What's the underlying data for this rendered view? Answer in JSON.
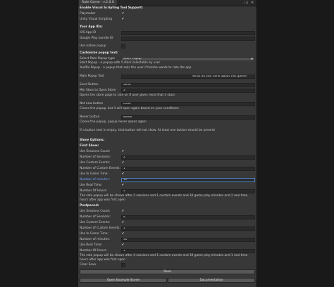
{
  "window": {
    "tab_title": "Rate Game - v.2.0.0",
    "menu_icon": "⋮",
    "restore_icon": "▫",
    "close_icon": "✕"
  },
  "visual_scripting": {
    "header": "Enable Visual Scripting Tool Support:",
    "playmaker_label": "Playmaker",
    "unity_label": "Unity Visual Scripting",
    "playmaker_checked": true,
    "unity_checked": true
  },
  "app_ids": {
    "header": "Your App IDs:",
    "ios_label": "iOS App ID",
    "google_label": "Google Play bundle ID",
    "ios_value": "",
    "google_value": "",
    "native_popup_label": "Use native popup",
    "native_popup_checked": false
  },
  "customize": {
    "header": "Customize popup text:",
    "popup_type_label": "Select Rate Popup type",
    "popup_type_value": "Stars Popup",
    "desc_start": "Start Popup - a popup with 5 stars selectable by user",
    "desc_yesno": "Yes/No Popup - a popup that asks the user if he/she wants to rate the app",
    "main_text_label": "Main Popup Text",
    "main_text_value": "What do you think about this game?",
    "send_label": "Send Button",
    "send_value": "Send",
    "min_stars_label": "Min Stars to Open Store",
    "min_stars_value": "3",
    "send_desc": "Opens the store page to rate on if user gives more that 3 stars",
    "not_now_label": "Not now button",
    "not_now_value": "Later",
    "not_now_desc": "Closes the popup, but it will open again based on your conditions",
    "never_label": "Never button",
    "never_value": "Never",
    "never_desc": "Closes the popup, popup never opens again",
    "empty_note": "If a button text is empty, that button will not show. At least one button should be present"
  },
  "show_options": {
    "header": "Show Options:",
    "first_header": "First Show:",
    "first": {
      "sessions_count_label": "Use Sessions Count:",
      "sessions_count_checked": true,
      "num_sessions_label": "Number of Sessions:",
      "num_sessions_value": "2",
      "custom_events_label": "Use Custom Events:",
      "custom_events_checked": true,
      "num_custom_label": "Number of Custom Events:",
      "num_custom_value": "1",
      "ingame_label": "Use In Game Time:",
      "ingame_checked": true,
      "num_minutes_label": "Number of minutes:",
      "num_minutes_value": "30",
      "real_time_label": "Use Real Time:",
      "real_time_checked": true,
      "num_hours_label": "Number Of Hours:",
      "num_hours_value": "2",
      "summary_1": "The rate popup will be shown after 2 sessions and 1 custom events and 30 game play minutes and 2 real time",
      "summary_2": "hours after app was first open"
    },
    "postponed_header": "Postponed:",
    "postponed": {
      "sessions_count_label": "Use Sessions Count:",
      "sessions_count_checked": true,
      "num_sessions_label": "Number of Sessions:",
      "num_sessions_value": "4",
      "custom_events_label": "Use Custom Events:",
      "custom_events_checked": true,
      "num_custom_label": "Number of Custom Events:",
      "num_custom_value": "1",
      "ingame_label": "Use In Game Time:",
      "ingame_checked": true,
      "num_minutes_label": "Number of minutes:",
      "num_minutes_value": "30",
      "real_time_label": "Use Real Time:",
      "real_time_checked": true,
      "num_hours_label": "Number Of Hours:",
      "num_hours_value": "1",
      "summary_1": "The rate popup will be shown after 4 sessions and 1 custom events and 30 game play minutes and 1 real time",
      "summary_2": "hours after app was first open"
    },
    "clear_save_label": "Clear Save",
    "clear_save_checked": false
  },
  "buttons": {
    "save": "Save",
    "open_example": "Open Example Scene",
    "documentation": "Documentation"
  },
  "icons": {
    "check": "✔",
    "dropdown": "▼"
  }
}
